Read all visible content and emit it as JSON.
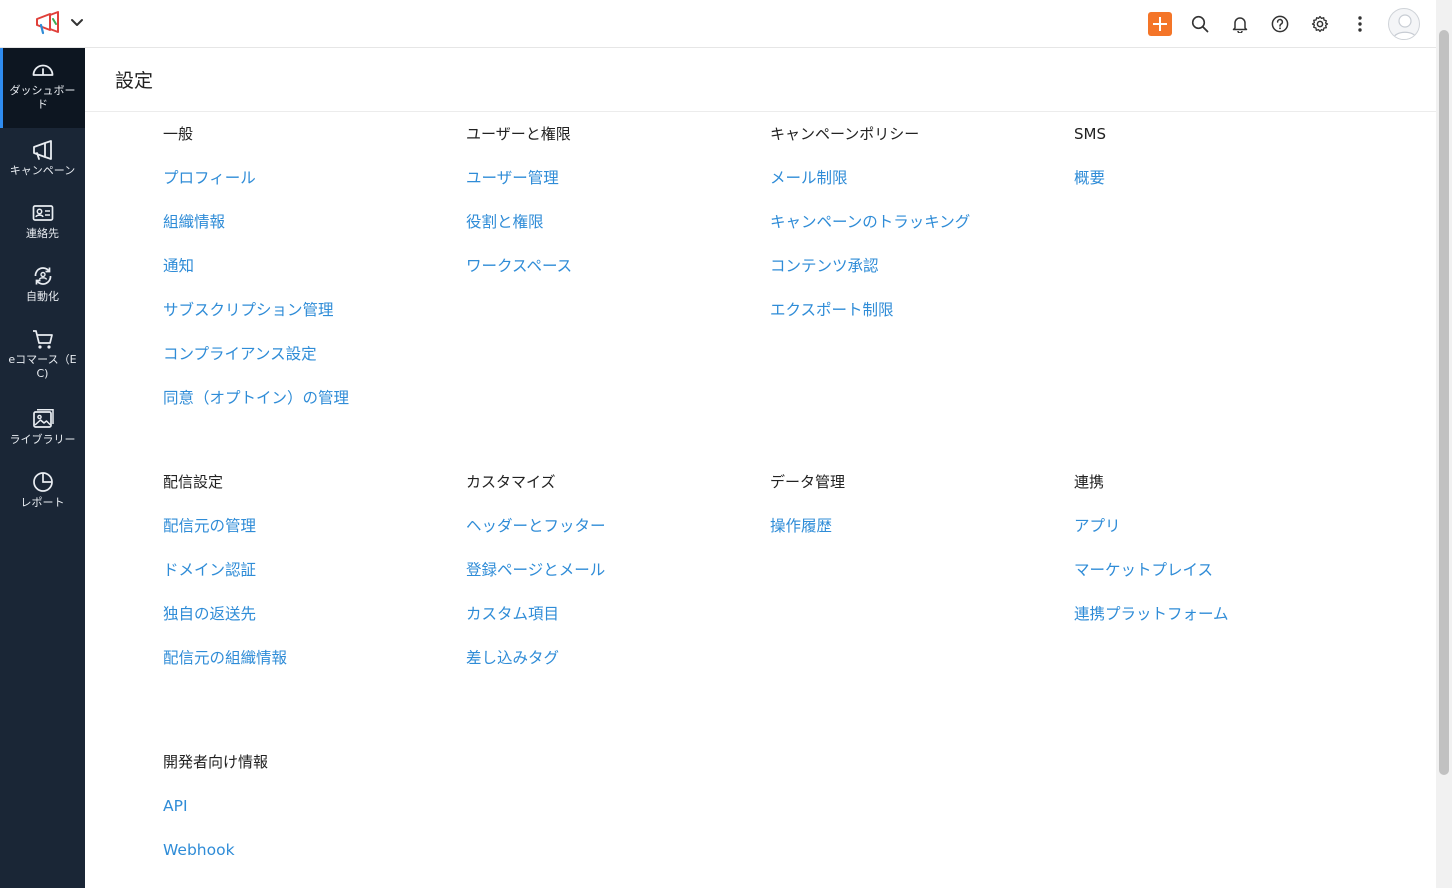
{
  "topbar": {
    "actions": [
      "add",
      "search",
      "notifications",
      "help",
      "settings",
      "more"
    ]
  },
  "sidebar": {
    "items": [
      {
        "label": "ダッシュボード",
        "icon": "dashboard-icon"
      },
      {
        "label": "キャンペーン",
        "icon": "megaphone-icon"
      },
      {
        "label": "連絡先",
        "icon": "contact-card-icon"
      },
      {
        "label": "自動化",
        "icon": "automation-icon"
      },
      {
        "label": "eコマース（EC)",
        "icon": "cart-icon"
      },
      {
        "label": "ライブラリー",
        "icon": "image-library-icon"
      },
      {
        "label": "レポート",
        "icon": "pie-chart-icon"
      }
    ]
  },
  "page": {
    "title": "設定"
  },
  "groups": [
    {
      "title": "一般",
      "links": [
        "プロフィール",
        "組織情報",
        "通知",
        "サブスクリプション管理",
        "コンプライアンス設定",
        "同意（オプトイン）の管理"
      ]
    },
    {
      "title": "ユーザーと権限",
      "links": [
        "ユーザー管理",
        "役割と権限",
        "ワークスペース"
      ]
    },
    {
      "title": "キャンペーンポリシー",
      "links": [
        "メール制限",
        "キャンペーンのトラッキング",
        "コンテンツ承認",
        "エクスポート制限"
      ]
    },
    {
      "title": "SMS",
      "links": [
        "概要"
      ]
    },
    {
      "title": "配信設定",
      "links": [
        "配信元の管理",
        "ドメイン認証",
        "独自の返送先",
        "配信元の組織情報"
      ]
    },
    {
      "title": "カスタマイズ",
      "links": [
        "ヘッダーとフッター",
        "登録ページとメール",
        "カスタム項目",
        "差し込みタグ"
      ]
    },
    {
      "title": "データ管理",
      "links": [
        "操作履歴"
      ]
    },
    {
      "title": "連携",
      "links": [
        "アプリ",
        "マーケットプレイス",
        "連携プラットフォーム"
      ]
    },
    {
      "title": "開発者向け情報",
      "links": [
        "API",
        "Webhook"
      ]
    }
  ],
  "colors": {
    "sidebar": "#1a2636",
    "accent": "#f47528",
    "link": "#2f8cd7",
    "active_indicator": "#2f8cf0"
  }
}
